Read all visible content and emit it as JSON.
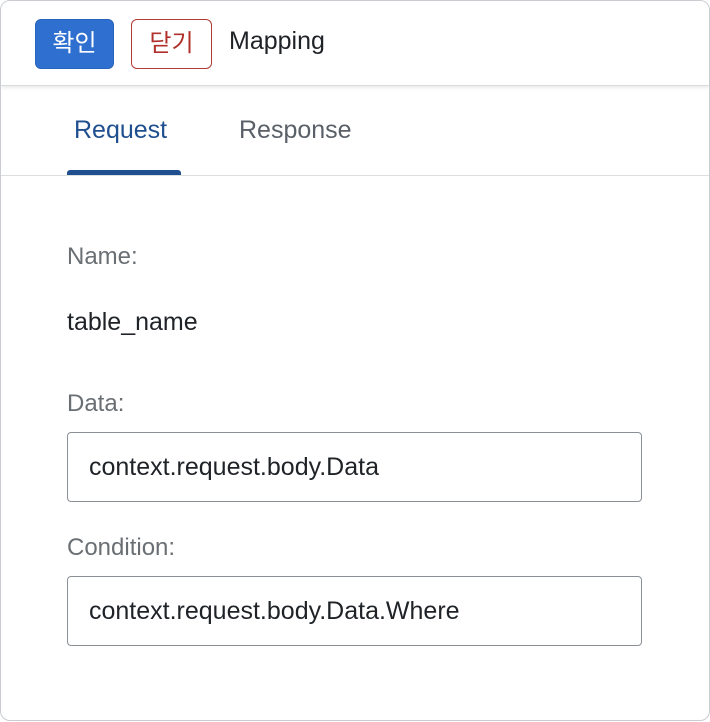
{
  "header": {
    "confirm_label": "확인",
    "close_label": "닫기",
    "title": "Mapping"
  },
  "tabs": {
    "request": "Request",
    "response": "Response",
    "active": "Request"
  },
  "form": {
    "name_label": "Name:",
    "name_value": "table_name",
    "data_label": "Data:",
    "data_value": "context.request.body.Data",
    "condition_label": "Condition:",
    "condition_value": "context.request.body.Data.Where"
  },
  "colors": {
    "confirm_button": "#2f6fd0",
    "close_button_border": "#b23b34",
    "active_tab": "#1f4f8f"
  }
}
